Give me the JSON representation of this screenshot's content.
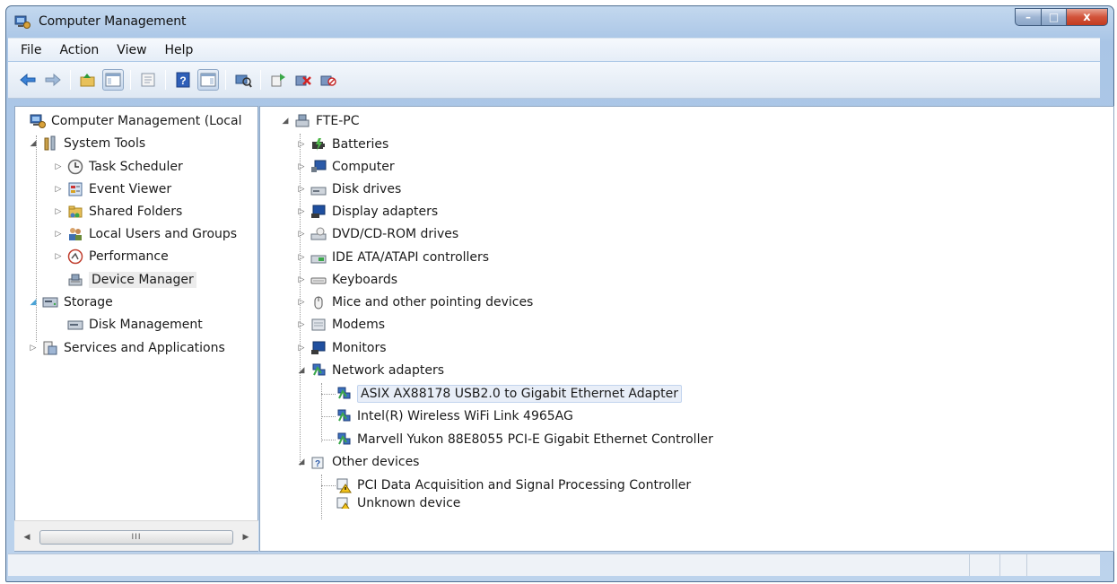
{
  "window": {
    "title": "Computer Management",
    "controls": {
      "minimize": "–",
      "maximize": "□",
      "close": "x"
    }
  },
  "menu": [
    "File",
    "Action",
    "View",
    "Help"
  ],
  "toolbar": {
    "buttons": [
      "back-icon",
      "forward-icon",
      "up-folder-icon",
      "show-hide-console-tree-icon",
      "properties-icon",
      "help-icon",
      "show-hide-action-pane-icon",
      "scan-hardware-icon",
      "update-driver-icon",
      "uninstall-device-icon",
      "disable-device-icon"
    ]
  },
  "left_tree": {
    "root": "Computer Management (Local",
    "system_tools": "System Tools",
    "task_scheduler": "Task Scheduler",
    "event_viewer": "Event Viewer",
    "shared_folders": "Shared Folders",
    "local_users": "Local Users and Groups",
    "performance": "Performance",
    "device_manager": "Device Manager",
    "storage": "Storage",
    "disk_management": "Disk Management",
    "services": "Services and Applications",
    "scroll_thumb": "III"
  },
  "device_tree": {
    "root": "FTE-PC",
    "categories": {
      "batteries": "Batteries",
      "computer": "Computer",
      "disk_drives": "Disk drives",
      "display_adapters": "Display adapters",
      "dvd": "DVD/CD-ROM drives",
      "ide": "IDE ATA/ATAPI controllers",
      "keyboards": "Keyboards",
      "mice": "Mice and other pointing devices",
      "modems": "Modems",
      "monitors": "Monitors",
      "network": "Network adapters",
      "other": "Other devices"
    },
    "network_devices": [
      "ASIX AX88178 USB2.0 to Gigabit Ethernet Adapter",
      "Intel(R) Wireless WiFi Link 4965AG",
      "Marvell Yukon 88E8055 PCI-E Gigabit Ethernet Controller"
    ],
    "other_devices": [
      "PCI Data Acquisition and Signal Processing Controller",
      "Unknown device"
    ]
  }
}
